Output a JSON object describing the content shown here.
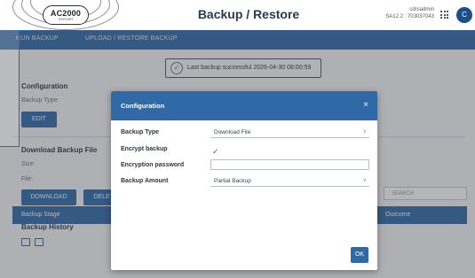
{
  "header": {
    "logo_text": "AC2000",
    "logo_sub": "SERVER",
    "title": "Backup / Restore",
    "user_line1": "cdrsadmin",
    "user_line2": "SA12.2 : 703037043",
    "avatar_letter": "C"
  },
  "tabs": [
    {
      "label": "RUN BACKUP"
    },
    {
      "label": "UPLOAD / RESTORE BACKUP"
    }
  ],
  "toast": {
    "icon": "check-circle-icon",
    "text": "Last backup successful 2026-04-30 08:00:59"
  },
  "configuration": {
    "title": "Configuration",
    "backup_type_label": "Backup Type:",
    "edit_button": "EDIT"
  },
  "download": {
    "title": "Download Backup File",
    "size_label": "Size:",
    "file_label": "File:",
    "download_button": "DOWNLOAD",
    "delete_button": "DELETE"
  },
  "history": {
    "title": "Backup History",
    "search_placeholder": "SEARCH",
    "columns": [
      "Backup Stage",
      "Outcome"
    ]
  },
  "modal": {
    "title": "Configuration",
    "close": "×",
    "backup_type_label": "Backup Type",
    "backup_type_value": "Download File",
    "encrypt_label": "Encrypt backup",
    "encrypt_checked": "✓",
    "password_label": "Encryption password",
    "password_value": "",
    "amount_label": "Backup Amount",
    "amount_value": "Partial Backup",
    "ok_button": "OK"
  },
  "colors": {
    "primary": "#2f6aa6",
    "accent_outline": "#1c6fb8"
  }
}
